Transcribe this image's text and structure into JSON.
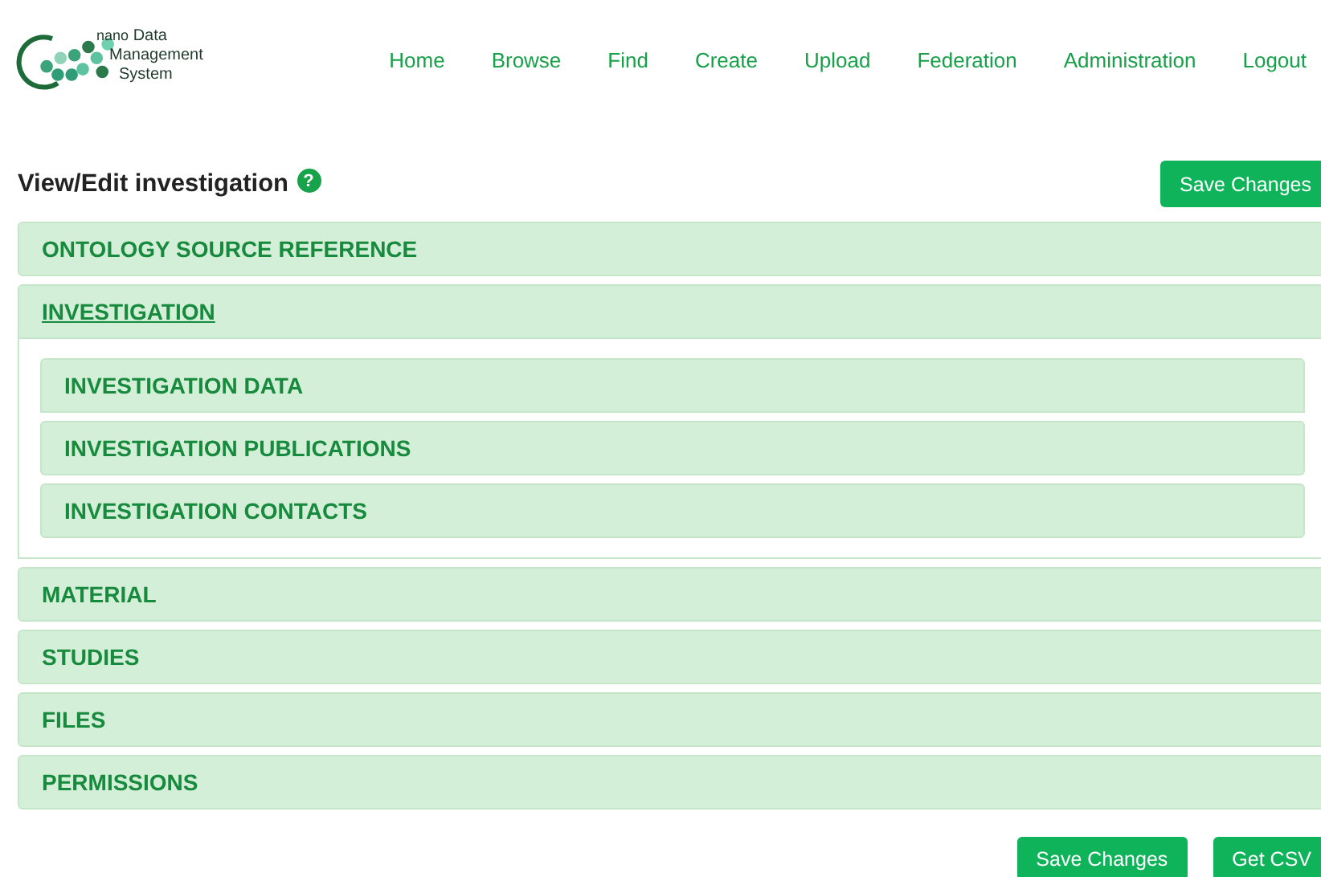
{
  "logo": {
    "lines": [
      "nano",
      "Data",
      "Management",
      "System"
    ]
  },
  "nav": [
    "Home",
    "Browse",
    "Find",
    "Create",
    "Upload",
    "Federation",
    "Administration",
    "Logout"
  ],
  "page_title": "View/Edit investigation",
  "help_icon": "?",
  "top_buttons": [
    "Save Changes"
  ],
  "sections": [
    {
      "title": "ONTOLOGY SOURCE REFERENCE",
      "expanded": false
    },
    {
      "title": "INVESTIGATION",
      "expanded": true,
      "children": [
        {
          "title": "INVESTIGATION DATA",
          "expanded": false
        },
        {
          "title": "INVESTIGATION PUBLICATIONS",
          "expanded": false
        },
        {
          "title": "INVESTIGATION CONTACTS",
          "expanded": false
        }
      ]
    },
    {
      "title": "MATERIAL",
      "expanded": false
    },
    {
      "title": "STUDIES",
      "expanded": false
    },
    {
      "title": "FILES",
      "expanded": false
    },
    {
      "title": "PERMISSIONS",
      "expanded": false
    }
  ],
  "bottom_buttons": [
    "Save Changes",
    "Get CSV"
  ]
}
